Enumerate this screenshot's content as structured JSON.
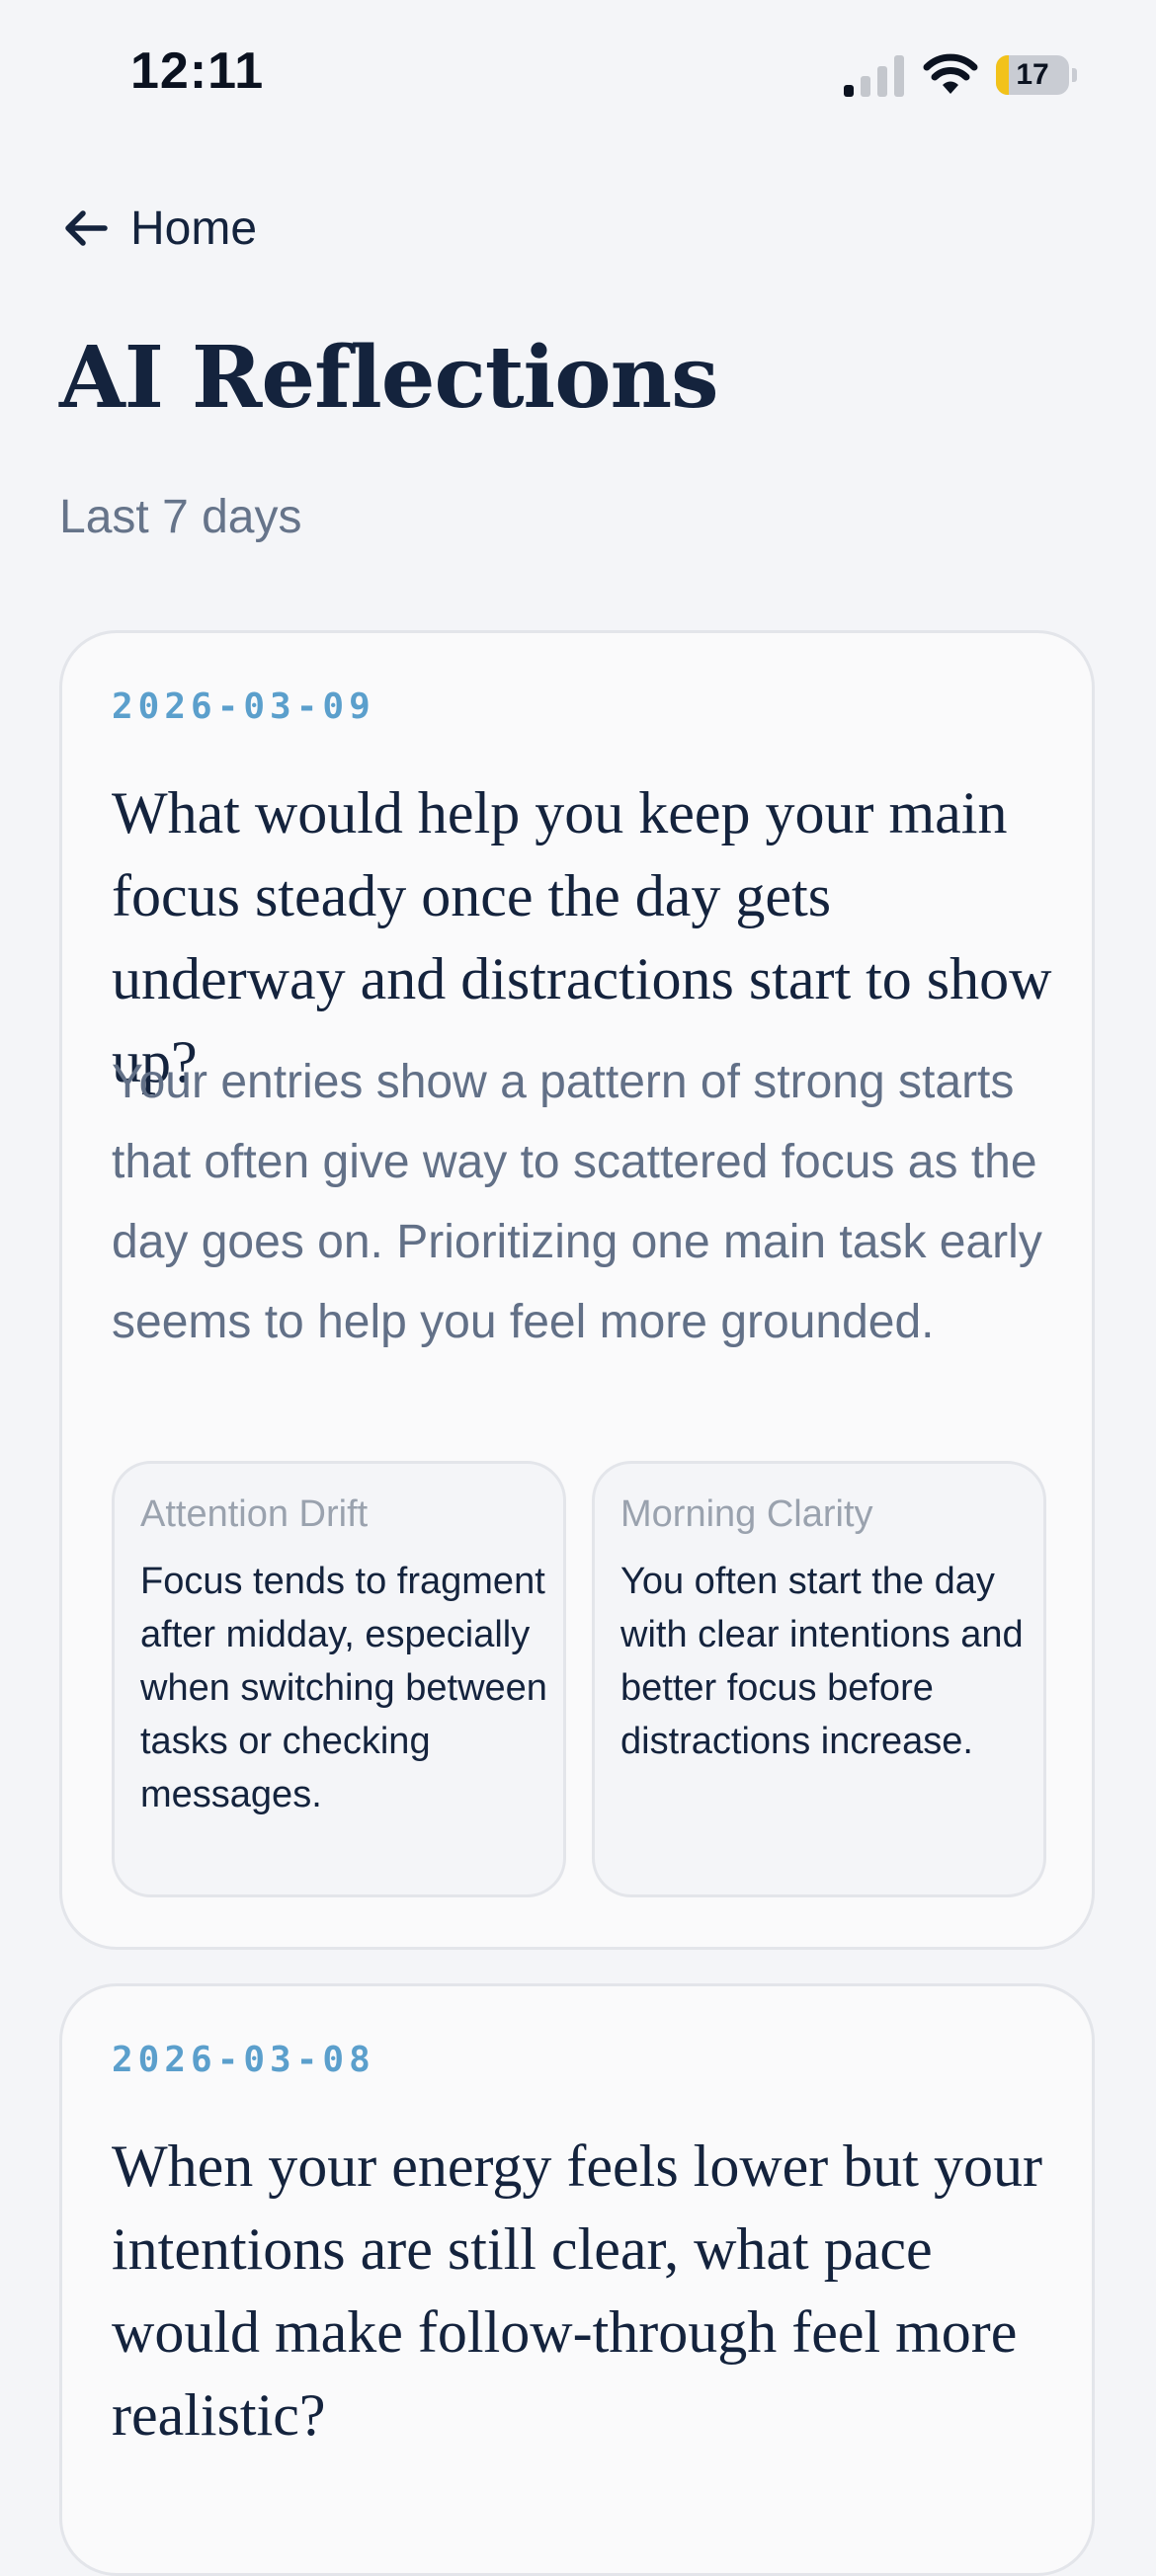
{
  "status_bar": {
    "time": "12:11",
    "battery_level": "17",
    "battery_fraction": 0.17
  },
  "nav": {
    "back_label": "Home"
  },
  "header": {
    "title": "AI Reflections",
    "subtitle": "Last 7 days"
  },
  "reflections": [
    {
      "date": "2026-03-09",
      "question": "What would help you keep your main focus steady once the day gets underway and distractions start to show up?",
      "summary": "Your entries show a pattern of strong starts that often give way to scattered focus as the day goes on. Prioritizing one main task early seems to help you feel more grounded.",
      "insights": [
        {
          "title": "Attention Drift",
          "body": "Focus tends to fragment after midday, especially when switching between tasks or checking messages."
        },
        {
          "title": "Morning Clarity",
          "body": "You often start the day with clear intentions and better focus before distractions increase."
        }
      ]
    },
    {
      "date": "2026-03-08",
      "question": "When your energy feels lower but your intentions are still clear, what pace would make follow-through feel more realistic?"
    }
  ],
  "colors": {
    "accent": "#5b9fcc",
    "title": "#14233d",
    "muted": "#66748a",
    "battery": "#f2c21a"
  }
}
